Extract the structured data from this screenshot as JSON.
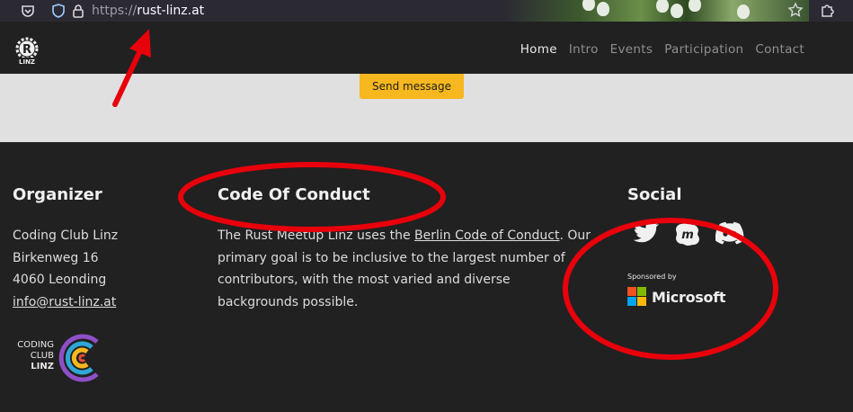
{
  "browser": {
    "url_scheme": "https://",
    "url_host": "rust-linz.at",
    "shield_icon": "shield-icon",
    "lock_icon": "lock-icon",
    "star_icon": "star-icon",
    "extensions_icon": "puzzle-icon",
    "pocket_icon": "pocket-icon"
  },
  "nav": {
    "logo_icon": "rust-linz-logo",
    "items": [
      {
        "label": "Home",
        "active": true
      },
      {
        "label": "Intro",
        "active": false
      },
      {
        "label": "Events",
        "active": false
      },
      {
        "label": "Participation",
        "active": false
      },
      {
        "label": "Contact",
        "active": false
      }
    ]
  },
  "form": {
    "send_label": "Send message"
  },
  "footer": {
    "organizer": {
      "title": "Organizer",
      "name": "Coding Club Linz",
      "street": "Birkenweg 16",
      "city": "4060 Leonding",
      "email": "info@rust-linz.at",
      "logo_line1": "CODING",
      "logo_line2": "CLUB",
      "logo_line3": "LINZ"
    },
    "coc": {
      "title": "Code Of Conduct",
      "text_before": "The Rust Meetup Linz uses the ",
      "link": "Berlin Code of Conduct",
      "text_after": ". Our primary goal is to be inclusive to the largest number of contributors, with the most varied and diverse backgrounds possible."
    },
    "social": {
      "title": "Social",
      "icons": [
        "twitter-icon",
        "meetup-icon",
        "discord-icon"
      ],
      "sponsored_label": "Sponsored by",
      "sponsor": "Microsoft"
    }
  },
  "colors": {
    "accent": "#f6b71f",
    "annotation": "#e8000b",
    "background": "#212121",
    "form_bg": "#e0e0e0"
  }
}
